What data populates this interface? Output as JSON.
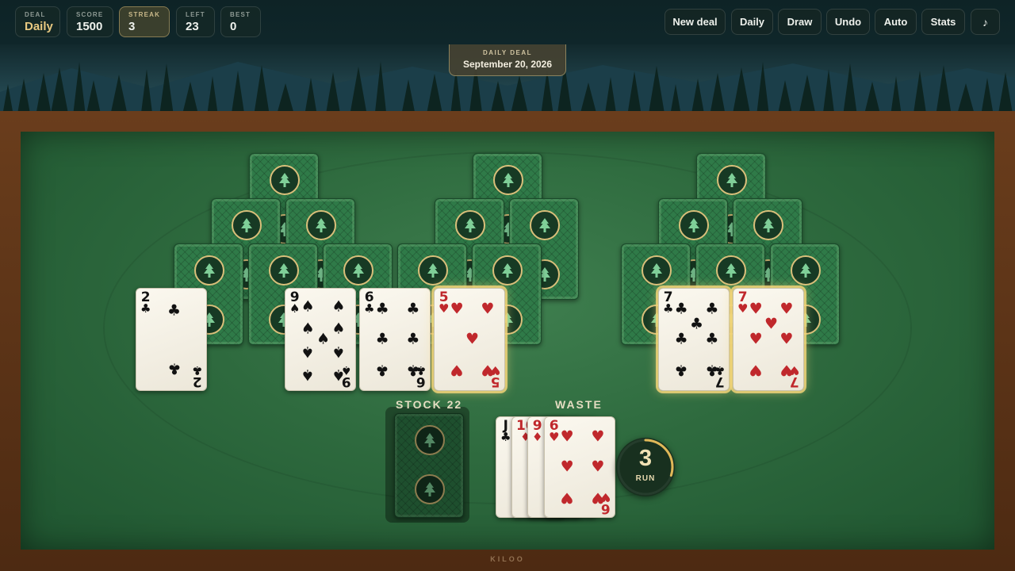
{
  "stats": [
    {
      "label": "DEAL",
      "value": "Daily"
    },
    {
      "label": "SCORE",
      "value": "1500"
    },
    {
      "label": "STREAK",
      "value": "3"
    },
    {
      "label": "LEFT",
      "value": "23"
    },
    {
      "label": "BEST",
      "value": "0"
    }
  ],
  "toolbar": {
    "new_deal": "New deal",
    "daily": "Daily",
    "draw": "Draw",
    "undo": "Undo",
    "auto": "Auto",
    "stats": "Stats",
    "music": "♪",
    "music_icon": "music-note-icon"
  },
  "daily_deal": {
    "label": "DAILY DEAL",
    "date": "September 20, 2026"
  },
  "card_back": {
    "emblem_icon": "pine-tree-icon",
    "color": "#2f7a48",
    "accent": "#d9bf7a"
  },
  "tableau_faceup": [
    {
      "rank": "2",
      "suit": "♣",
      "color": "black"
    },
    {
      "rank": "9",
      "suit": "♠",
      "color": "black"
    },
    {
      "rank": "6",
      "suit": "♣",
      "color": "black"
    },
    {
      "rank": "5",
      "suit": "♥",
      "color": "red",
      "highlighted": true
    },
    {
      "rank": "7",
      "suit": "♣",
      "color": "black",
      "highlighted": true
    },
    {
      "rank": "7",
      "suit": "♥",
      "color": "red",
      "highlighted": true
    }
  ],
  "stock": {
    "label": "STOCK 22"
  },
  "waste": {
    "label": "WASTE",
    "cards": [
      {
        "rank": "J",
        "suit": "♣",
        "color": "black"
      },
      {
        "rank": "10",
        "suit": "♦",
        "color": "red"
      },
      {
        "rank": "9",
        "suit": "♦",
        "color": "red"
      },
      {
        "rank": "6",
        "suit": "♥",
        "color": "red"
      }
    ]
  },
  "run": {
    "value": "3",
    "label": "RUN",
    "progress": 0.3
  },
  "footer": {
    "brand": "KILOO"
  }
}
